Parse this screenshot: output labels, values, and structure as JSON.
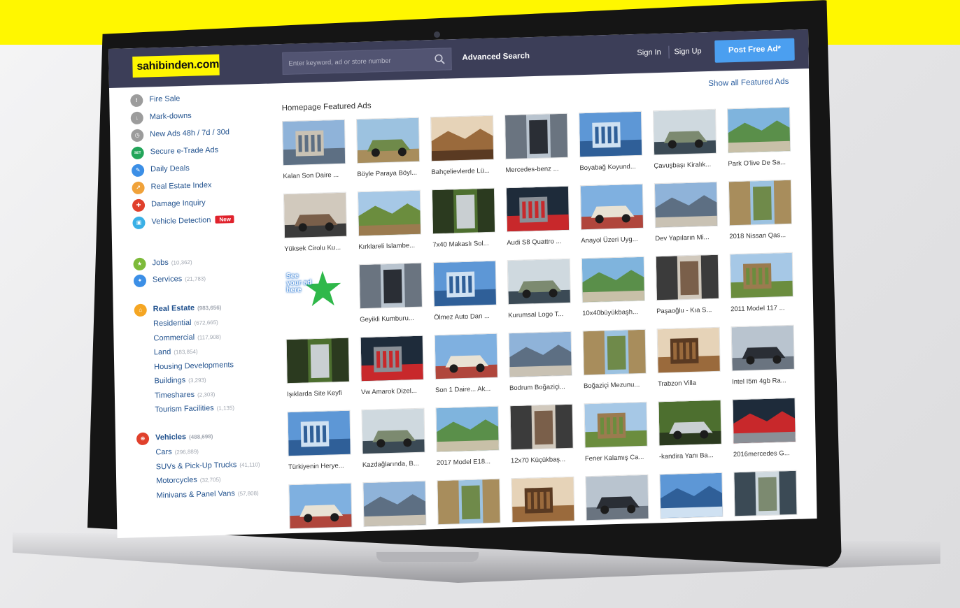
{
  "colors": {
    "banner": "#fff700",
    "header": "#3c3e58",
    "accent": "#4b9ff0",
    "link": "#23538f"
  },
  "header": {
    "logo": "sahibinden.com",
    "search_placeholder": "Enter keyword, ad or store number",
    "advanced_search": "Advanced Search",
    "sign_in": "Sign In",
    "sign_up": "Sign Up",
    "post_free_ad": "Post Free Ad*"
  },
  "sidebar": {
    "quick_links": [
      {
        "label": "Fire Sale",
        "icon": "fire-sale-icon",
        "color": "#9c9c9c"
      },
      {
        "label": "Mark-downs",
        "icon": "price-down-icon",
        "color": "#9c9c9c"
      },
      {
        "label": "New Ads 48h / 7d / 30d",
        "icon": "clock-icon",
        "color": "#9c9c9c"
      },
      {
        "label": "Secure e-Trade Ads",
        "icon": "secure-trade-icon",
        "color": "#23a55a"
      },
      {
        "label": "Daily Deals",
        "icon": "tag-icon",
        "color": "#3c8fe6"
      },
      {
        "label": "Real Estate Index",
        "icon": "chart-icon",
        "color": "#f0a23a"
      },
      {
        "label": "Damage Inquiry",
        "icon": "car-damage-icon",
        "color": "#e0402c"
      },
      {
        "label": "Vehicle Detection",
        "icon": "vehicle-icon",
        "color": "#3ab0e6"
      }
    ],
    "new_badge": "New",
    "jobs": {
      "label": "Jobs",
      "count": "(10,362)"
    },
    "services": {
      "label": "Services",
      "count": "(21,783)"
    },
    "real_estate": {
      "label": "Real Estate",
      "count": "(983,656)",
      "items": [
        {
          "label": "Residential",
          "count": "(672,665)"
        },
        {
          "label": "Commercial",
          "count": "(117,908)"
        },
        {
          "label": "Land",
          "count": "(183,854)"
        },
        {
          "label": "Housing Developments",
          "count": ""
        },
        {
          "label": "Buildings",
          "count": "(3,293)"
        },
        {
          "label": "Timeshares",
          "count": "(2,303)"
        },
        {
          "label": "Tourism Facilities",
          "count": "(1,135)"
        }
      ]
    },
    "vehicles": {
      "label": "Vehicles",
      "count": "(488,698)",
      "items": [
        {
          "label": "Cars",
          "count": "(296,889)"
        },
        {
          "label": "SUVs & Pick-Up Trucks",
          "count": "(41,110)"
        },
        {
          "label": "Motorcycles",
          "count": "(32,705)"
        },
        {
          "label": "Minivans & Panel Vans",
          "count": "(57,808)"
        }
      ]
    }
  },
  "main": {
    "title": "Homepage Featured Ads",
    "show_all": "Show all Featured Ads",
    "promo": {
      "line1": "See",
      "line2": "your ad",
      "line3": "here"
    },
    "rows": [
      [
        "Kalan Son Daire ...",
        "Böyle Paraya Böyl...",
        "Bahçelievlerde Lü...",
        "Mercedes-benz ...",
        "Boyabağ Koyund...",
        "Çavuşbaşı Kiralık...",
        "Park O'live De Sa..."
      ],
      [
        "Yüksek Cirolu Ku...",
        "Kırklareli Islambe...",
        "7x40 Makaslı Sol...",
        "Audi S8 Quattro ...",
        "Anayol Üzeri Uyg...",
        "Dev Yapıların Mi...",
        "2018 Nissan Qas..."
      ],
      [
        "",
        "Geyikli Kumburu...",
        "Ölmez Auto Dan ...",
        "Kurumsal Logo T...",
        "10x40büyükbaşh...",
        "Paşaoğlu - Kıa S...",
        "2011 Model 117 ..."
      ],
      [
        "Işıklarda Site Keyfi",
        "Vw Amarok Dizel...",
        "Son 1 Daire... Ak...",
        "Bodrum Boğaziçi...",
        "Boğaziçi Mezunu...",
        "Trabzon Villa",
        "Intel I5m 4gb Ra..."
      ],
      [
        "Türkiyenin Herye...",
        "Kazdağlarında, B...",
        "2017 Model E18...",
        "12x70 Küçükbaş...",
        "Fener Kalamış Ca...",
        "-kandira Yanı Ba...",
        "2016mercedes G..."
      ],
      [
        "",
        "",
        "",
        "",
        "",
        "",
        ""
      ]
    ]
  }
}
